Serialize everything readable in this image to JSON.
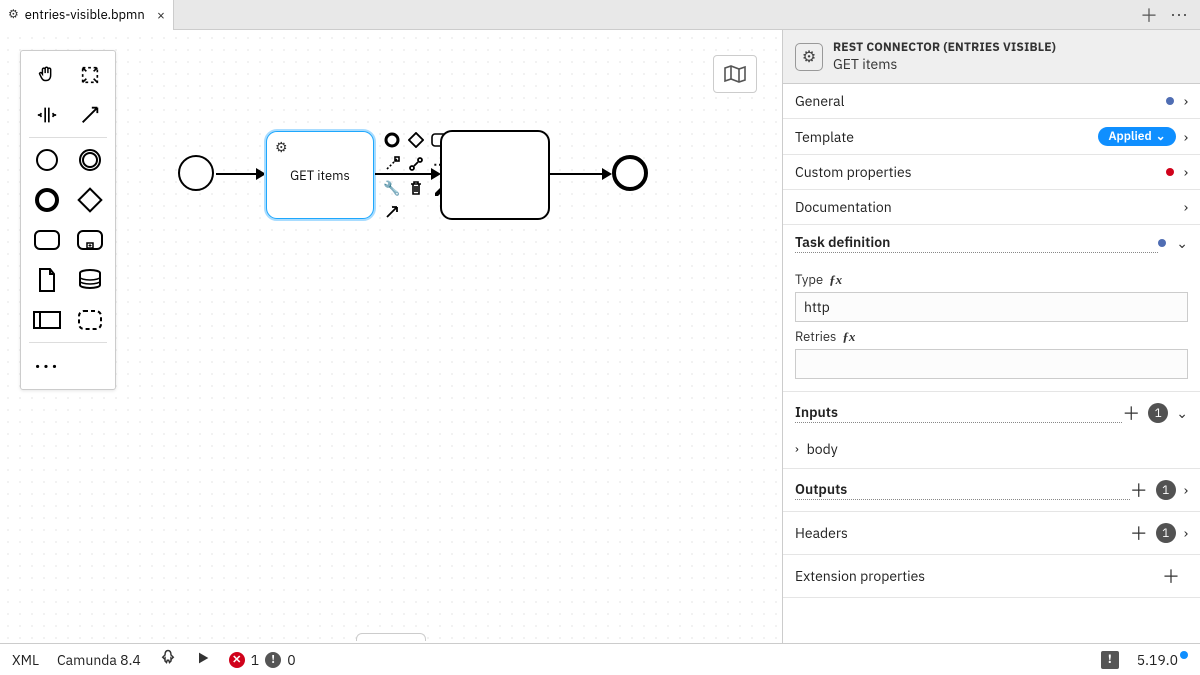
{
  "tab": {
    "filename": "entries-visible.bpmn"
  },
  "canvas": {
    "selected_task_label": "GET items"
  },
  "panel": {
    "header_title": "REST CONNECTOR (ENTRIES VISIBLE)",
    "header_subtitle": "GET items",
    "groups": {
      "general": "General",
      "template": "Template",
      "template_badge": "Applied",
      "custom_properties": "Custom properties",
      "documentation": "Documentation",
      "task_definition": "Task definition",
      "inputs": "Inputs",
      "outputs": "Outputs",
      "headers": "Headers",
      "extension_properties": "Extension properties"
    },
    "task_def": {
      "type_label": "Type",
      "type_value": "http",
      "retries_label": "Retries",
      "retries_value": ""
    },
    "inputs": {
      "count": "1",
      "item0": "body"
    },
    "outputs_count": "1",
    "headers_count": "1"
  },
  "status": {
    "xml": "XML",
    "engine": "Camunda 8.4",
    "errors": "1",
    "warnings": "0",
    "version": "5.19.0"
  }
}
